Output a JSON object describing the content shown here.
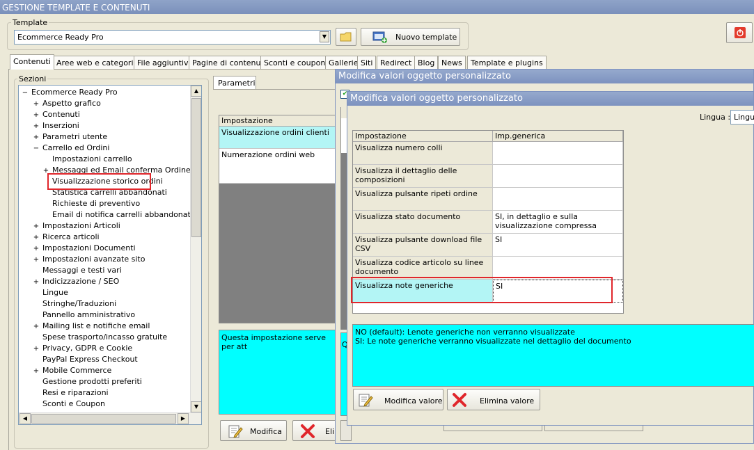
{
  "window": {
    "title": "GESTIONE TEMPLATE E CONTENUTI"
  },
  "template_group": {
    "label": "Template",
    "selected": "Ecommerce Ready Pro",
    "new_button": "Nuovo template"
  },
  "tabs": [
    "Contenuti",
    "Aree web e categorie",
    "File aggiuntivi",
    "Pagine di contenuti",
    "Sconti e coupon",
    "Gallerie",
    "Siti",
    "Redirect",
    "Blog",
    "News",
    "Template e plugins"
  ],
  "sections": {
    "label": "Sezioni",
    "tree": [
      {
        "label": "Ecommerce Ready Pro",
        "level": 0,
        "expander": "−"
      },
      {
        "label": "Aspetto grafico",
        "level": 1,
        "expander": "+"
      },
      {
        "label": "Contenuti",
        "level": 1,
        "expander": "+"
      },
      {
        "label": "Inserzioni",
        "level": 1,
        "expander": "+"
      },
      {
        "label": "Parametri utente",
        "level": 1,
        "expander": "+"
      },
      {
        "label": "Carrello ed Ordini",
        "level": 1,
        "expander": "−"
      },
      {
        "label": "Impostazioni carrello",
        "level": 2,
        "expander": ""
      },
      {
        "label": "Messaggi ed Email conferma Ordine",
        "level": 2,
        "expander": "+"
      },
      {
        "label": "Visualizzazione storico ordini",
        "level": 2,
        "expander": ""
      },
      {
        "label": "Statistica carrelli abbandonati",
        "level": 2,
        "expander": ""
      },
      {
        "label": "Richieste di preventivo",
        "level": 2,
        "expander": ""
      },
      {
        "label": "Email di notifica carrelli abbandonati",
        "level": 2,
        "expander": ""
      },
      {
        "label": "Impostazioni Articoli",
        "level": 1,
        "expander": "+"
      },
      {
        "label": "Ricerca articoli",
        "level": 1,
        "expander": "+"
      },
      {
        "label": "Impostazioni Documenti",
        "level": 1,
        "expander": "+"
      },
      {
        "label": "Impostazioni avanzate sito",
        "level": 1,
        "expander": "+"
      },
      {
        "label": "Messaggi e testi vari",
        "level": 1,
        "expander": ""
      },
      {
        "label": "Indicizzazione / SEO",
        "level": 1,
        "expander": "+"
      },
      {
        "label": "Lingue",
        "level": 1,
        "expander": ""
      },
      {
        "label": "Stringhe/Traduzioni",
        "level": 1,
        "expander": ""
      },
      {
        "label": "Pannello amministrativo",
        "level": 1,
        "expander": ""
      },
      {
        "label": "Mailing list e notifiche email",
        "level": 1,
        "expander": "+"
      },
      {
        "label": "Spese trasporto/incasso gratuite",
        "level": 1,
        "expander": ""
      },
      {
        "label": "Privacy, GDPR e Cookie",
        "level": 1,
        "expander": "+"
      },
      {
        "label": "PayPal Express Checkout",
        "level": 1,
        "expander": ""
      },
      {
        "label": "Mobile Commerce",
        "level": 1,
        "expander": "+"
      },
      {
        "label": "Gestione prodotti preferiti",
        "level": 1,
        "expander": ""
      },
      {
        "label": "Resi e riparazioni",
        "level": 1,
        "expander": ""
      },
      {
        "label": "Sconti e Coupon",
        "level": 1,
        "expander": ""
      }
    ]
  },
  "params": {
    "tab": "Parametri",
    "header": "Impostazione",
    "rows": [
      "Visualizzazione ordini clienti",
      "Numerazione ordini web"
    ],
    "description": "Questa impostazione serve per att",
    "modify_button": "Modifica",
    "delete_button": "Elim"
  },
  "dialog_outer": {
    "title": "Modifica valori oggetto personalizzato",
    "partial_text": "Q"
  },
  "dialog_inner": {
    "title": "Modifica valori oggetto personalizzato",
    "language_label": "Lingua :",
    "language_value": "Lingua",
    "columns": [
      "Impostazione",
      "Imp.generica"
    ],
    "rows": [
      {
        "setting": "Visualizza numero colli",
        "value": ""
      },
      {
        "setting": "Visualizza il dettaglio delle composizioni",
        "value": ""
      },
      {
        "setting": "Visualizza pulsante ripeti ordine",
        "value": ""
      },
      {
        "setting": "Visualizza stato documento",
        "value": "SI, in dettaglio e sulla visualizzazione compressa"
      },
      {
        "setting": "Visualizza pulsante download file CSV",
        "value": "SI"
      },
      {
        "setting": "Visualizza codice articolo su linee documento",
        "value": ""
      },
      {
        "setting": "Visualizza note generiche",
        "value": "SI"
      }
    ],
    "help_lines": [
      "NO (default): Lenote generiche non verranno visualizzate",
      "SI: Le note generiche verranno visualizzate nel dettaglio del documento"
    ],
    "modify_button": "Modifica valore",
    "delete_button": "Elimina valore"
  },
  "colors": {
    "cyan": "#00ffff",
    "light_cyan": "#b3f5f5",
    "highlight": "#e0262b",
    "titlebar": "#8194c0"
  }
}
